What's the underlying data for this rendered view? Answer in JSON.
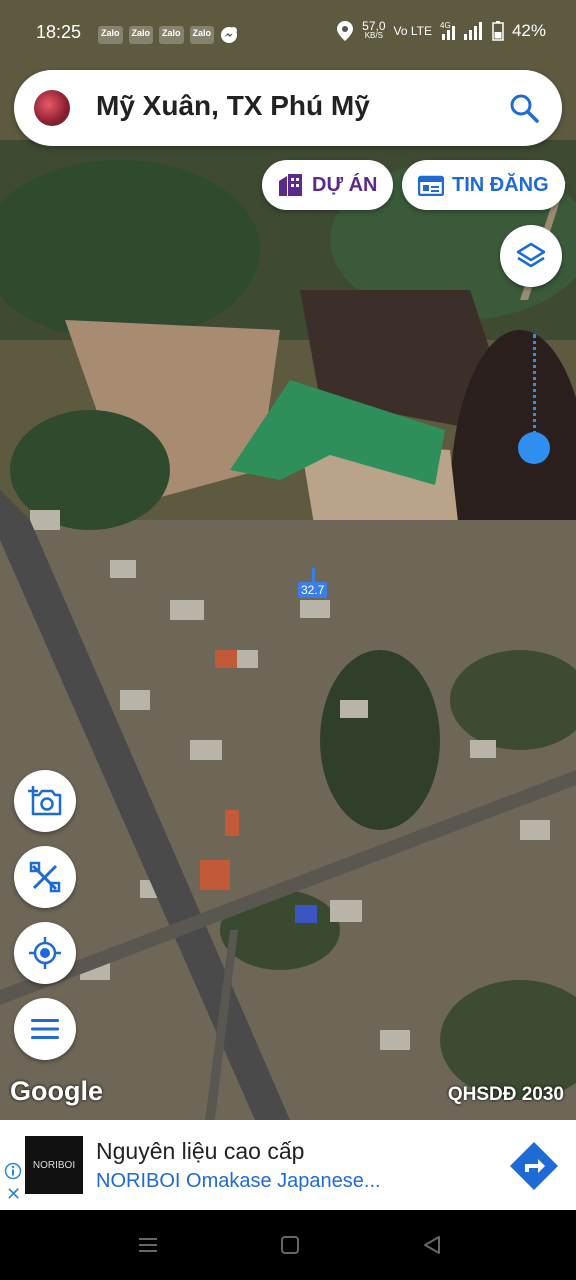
{
  "status": {
    "time": "18:25",
    "apps": [
      "Zalo",
      "Zalo",
      "Zalo",
      "Zalo"
    ],
    "speed_value": "57,0",
    "speed_unit": "KB/S",
    "network": "Vo LTE",
    "signal_label": "4G",
    "battery": "42%"
  },
  "search": {
    "location": "Mỹ Xuân, TX Phú Mỹ"
  },
  "chips": {
    "du_an": "DỰ ÁN",
    "tin_dang": "TIN ĐĂNG"
  },
  "map": {
    "pin_value": "32.7",
    "logo": "Google",
    "plan_label": "QHSDĐ 2030"
  },
  "ad": {
    "title": "Nguyên liệu cao cấp",
    "subtitle": "NORIBOI Omakase Japanese...",
    "logo_text": "NORIBOI",
    "close": "✕"
  },
  "icons": [
    "layers-icon",
    "camera-add-icon",
    "ruler-icon",
    "locate-icon",
    "menu-icon",
    "search-icon",
    "building-icon",
    "listing-icon",
    "directions-icon",
    "info-icon"
  ]
}
